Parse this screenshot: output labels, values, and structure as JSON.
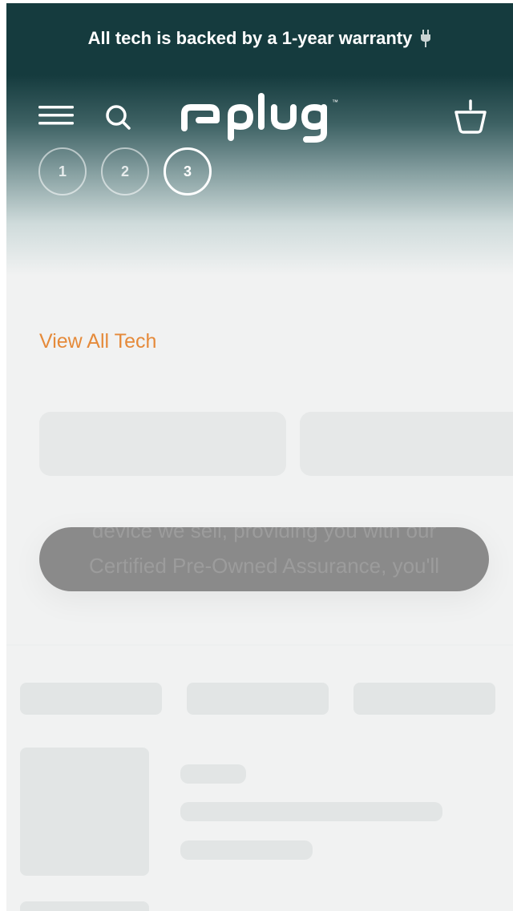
{
  "announcement": {
    "text": "All tech is backed by a 1-year warranty",
    "icon": "plug-icon"
  },
  "header": {
    "logo_text": "plug",
    "icons": {
      "menu": "hamburger-menu-icon",
      "search": "search-icon",
      "cart": "basket-icon"
    }
  },
  "steps": [
    {
      "label": "1",
      "active": false
    },
    {
      "label": "2",
      "active": false
    },
    {
      "label": "3",
      "active": true
    }
  ],
  "main": {
    "view_all_label": "View All Tech",
    "faded_text_line1": "device we sell, providing you with our",
    "faded_text_line2": "Certified Pre-Owned Assurance, you'll"
  },
  "colors": {
    "brand_dark": "#153b3e",
    "accent_orange": "#e58a3a",
    "background": "#f1f2f2",
    "skeleton": "#e2e5e5"
  }
}
